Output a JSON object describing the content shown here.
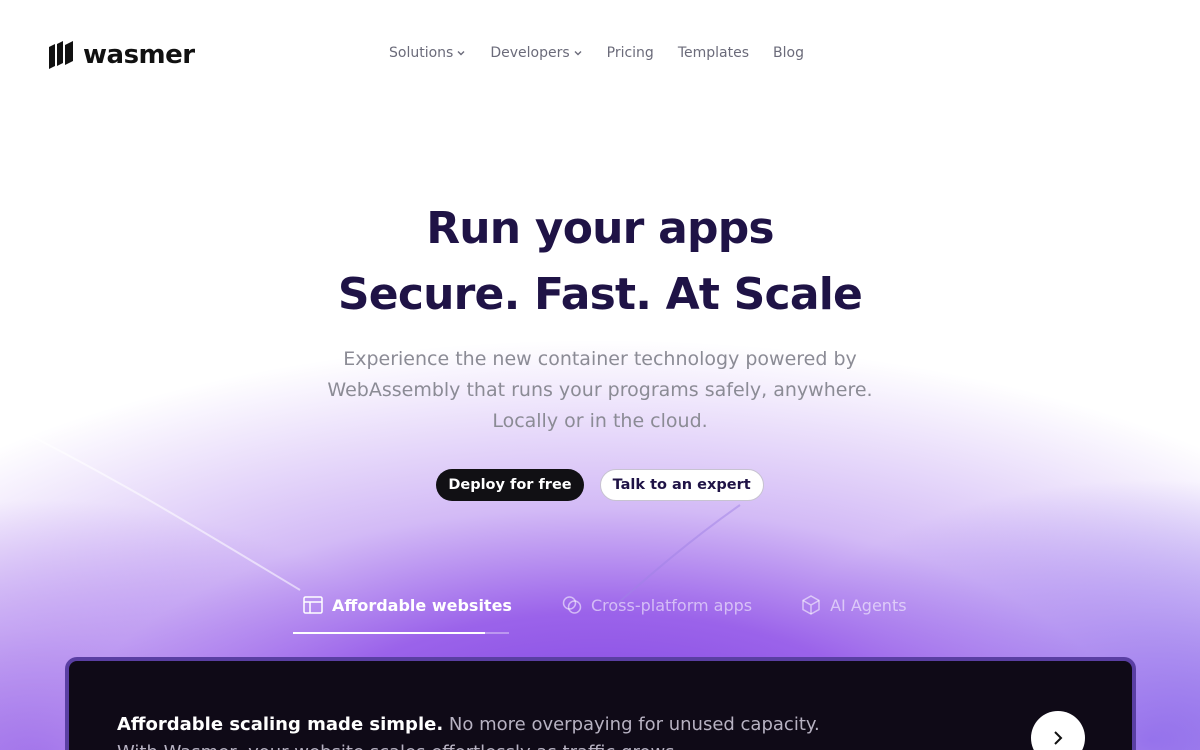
{
  "brand": {
    "name": "wasmer"
  },
  "nav": {
    "items": [
      {
        "label": "Solutions",
        "has_dropdown": true
      },
      {
        "label": "Developers",
        "has_dropdown": true
      },
      {
        "label": "Pricing",
        "has_dropdown": false
      },
      {
        "label": "Templates",
        "has_dropdown": false
      },
      {
        "label": "Blog",
        "has_dropdown": false
      }
    ]
  },
  "hero": {
    "title_line1": "Run your apps",
    "title_line2": "Secure. Fast. At Scale",
    "subtitle_line1": "Experience the new container technology powered by",
    "subtitle_line2": "WebAssembly that runs your programs safely, anywhere.",
    "subtitle_line3": "Locally or in the cloud."
  },
  "cta": {
    "primary_label": "Deploy for free",
    "secondary_label": "Talk to an expert"
  },
  "tabs": [
    {
      "label": "Affordable websites",
      "icon": "layout-icon",
      "active": true
    },
    {
      "label": "Cross-platform apps",
      "icon": "circles-icon",
      "active": false
    },
    {
      "label": "AI Agents",
      "icon": "cube-icon",
      "active": false
    }
  ],
  "panel": {
    "headline": "Affordable scaling made simple.",
    "body": "No more overpaying for unused capacity.",
    "body_line2": "With Wasmer, your website scales effortlessly as traffic grows."
  },
  "colors": {
    "heading": "#1f1346",
    "subtitle": "#8b8b95",
    "primary_button": "#111014",
    "panel_bg": "#0f0a17",
    "accent_purple": "#7b3fe0"
  }
}
